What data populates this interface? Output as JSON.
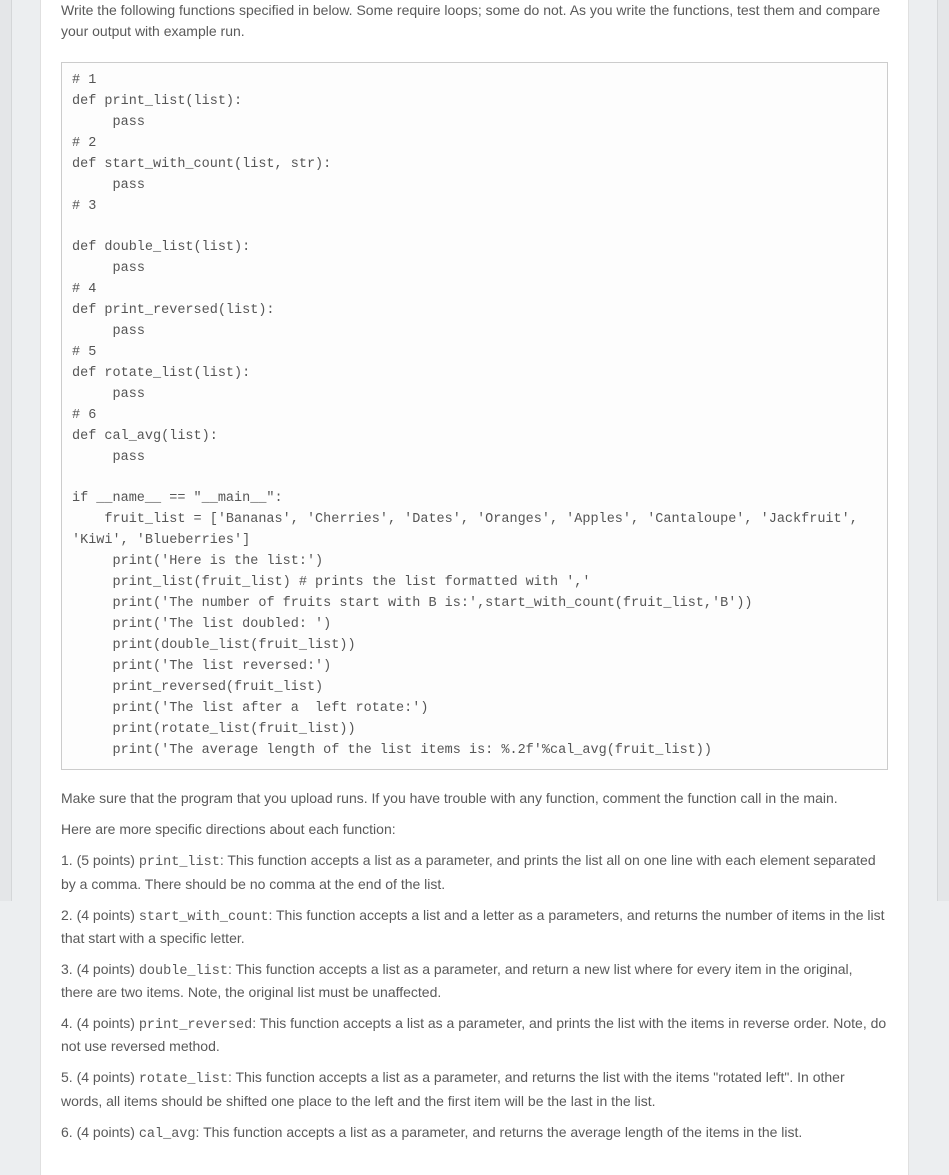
{
  "intro": "Write the following functions specified in below. Some require loops; some do not. As you write the functions, test them and compare your output with example run.",
  "code": "# 1\ndef print_list(list):\n     pass\n# 2\ndef start_with_count(list, str):\n     pass\n# 3\n\ndef double_list(list):\n     pass\n# 4\ndef print_reversed(list):\n     pass\n# 5\ndef rotate_list(list):\n     pass\n# 6\ndef cal_avg(list):\n     pass\n\nif __name__ == \"__main__\":\n    fruit_list = ['Bananas', 'Cherries', 'Dates', 'Oranges', 'Apples', 'Cantaloupe', 'Jackfruit', 'Kiwi', 'Blueberries']\n     print('Here is the list:')\n     print_list(fruit_list) # prints the list formatted with ','\n     print('The number of fruits start with B is:',start_with_count(fruit_list,'B'))\n     print('The list doubled: ')\n     print(double_list(fruit_list))\n     print('The list reversed:')\n     print_reversed(fruit_list)\n     print('The list after a  left rotate:')\n     print(rotate_list(fruit_list))\n     print('The average length of the list items is: %.2f'%cal_avg(fruit_list))",
  "after_code_note": "Make sure that the program that you upload runs. If you have trouble with any function, comment the function call in the main.",
  "directions_header": "Here are more specific directions about each function:",
  "items": [
    {
      "prefix": "1. (5 points) ",
      "fn": "print_list",
      "desc": ": This function accepts a list as a parameter, and prints the list all on one line with each element separated by a comma. There should be no comma at the end of the list."
    },
    {
      "prefix": "2. (4 points) ",
      "fn": "start_with_count",
      "desc": ": This function accepts a list and a letter as a parameters, and returns the number of items in the list that start with a specific letter."
    },
    {
      "prefix": "3. (4 points) ",
      "fn": "double_list",
      "desc": ": This function accepts a list as a parameter, and return a new list where for every item in the original, there are two items. Note, the original list must be unaffected."
    },
    {
      "prefix": "4. (4 points) ",
      "fn": "print_reversed",
      "desc": ": This function accepts a list as a parameter, and prints the list with the items in reverse order. Note, do not use reversed method."
    },
    {
      "prefix": "5. (4 points) ",
      "fn": "rotate_list",
      "desc": ": This function accepts a list as a parameter, and returns the list with the items \"rotated left\". In other words, all items should be shifted one place to the left and the first item will be the last in the list."
    },
    {
      "prefix": "6. (4 points) ",
      "fn": "cal_avg",
      "desc": ": This function accepts a list as a parameter, and returns the average length of the items in the list."
    }
  ]
}
